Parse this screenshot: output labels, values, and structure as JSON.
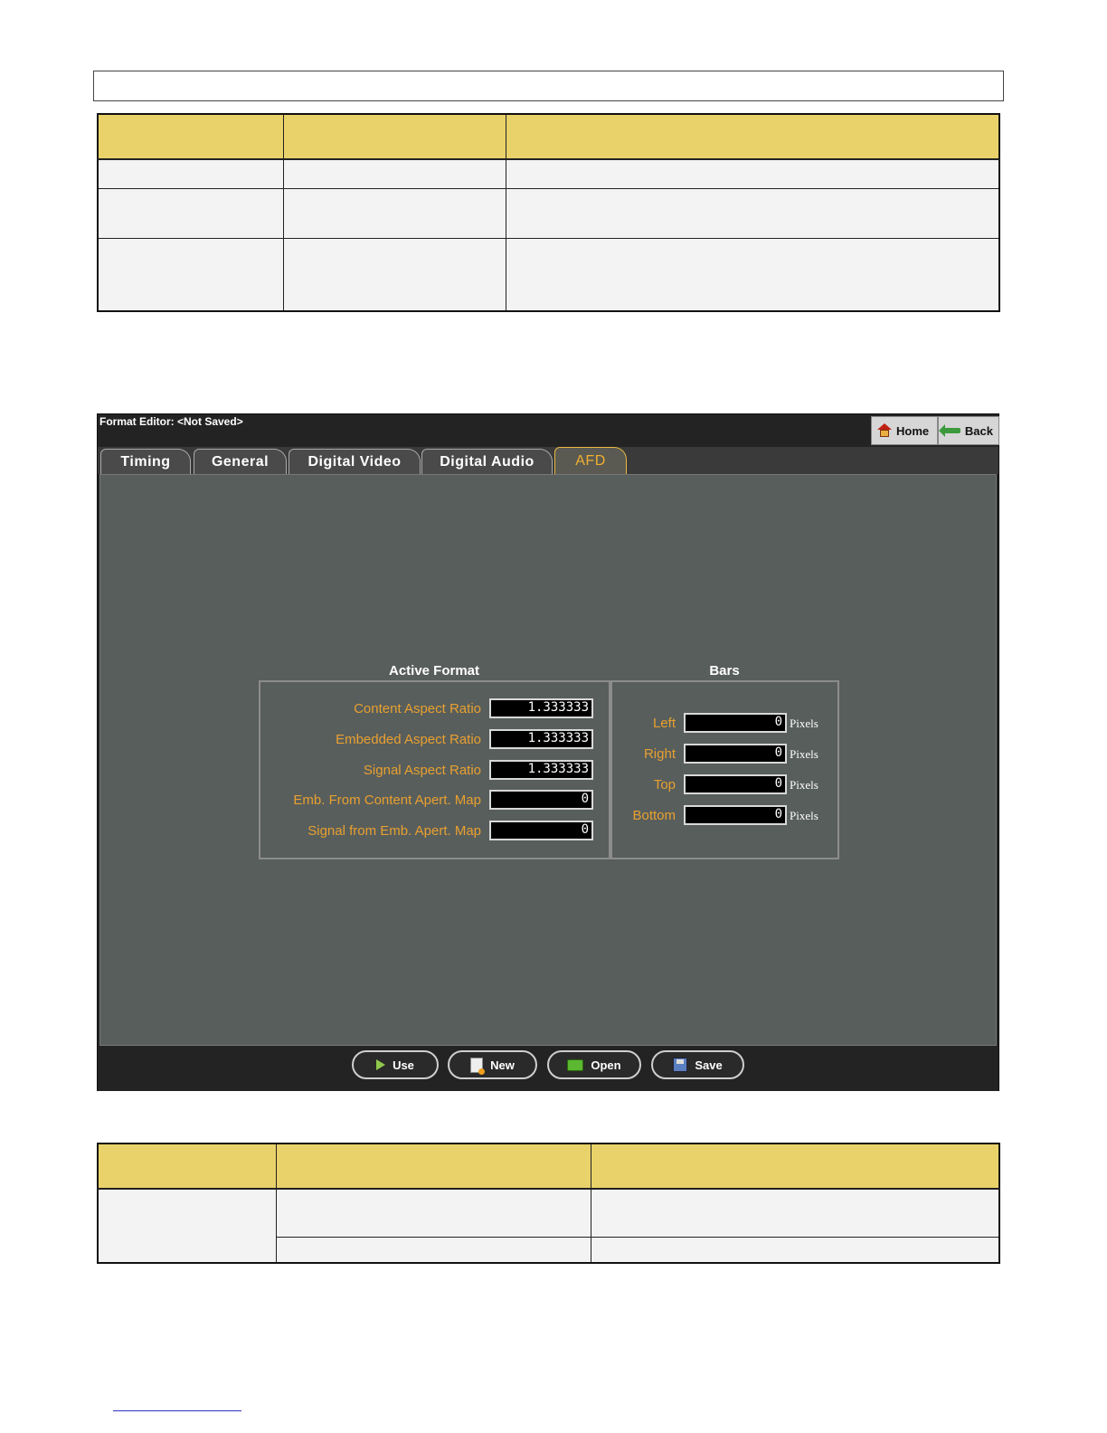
{
  "app": {
    "title": "Format Editor: <Not Saved>",
    "nav": {
      "home": "Home",
      "back": "Back"
    },
    "tabs": [
      {
        "label": "Timing"
      },
      {
        "label": "General"
      },
      {
        "label": "Digital Video"
      },
      {
        "label": "Digital Audio"
      },
      {
        "label": "AFD",
        "active": true
      }
    ],
    "active_format": {
      "title": "Active Format",
      "fields": [
        {
          "label": "Content Aspect Ratio",
          "value": "1.333333"
        },
        {
          "label": "Embedded Aspect Ratio",
          "value": "1.333333"
        },
        {
          "label": "Signal Aspect Ratio",
          "value": "1.333333"
        },
        {
          "label": "Emb. From Content Apert. Map",
          "value": "0"
        },
        {
          "label": "Signal from Emb. Apert. Map",
          "value": "0"
        }
      ]
    },
    "bars": {
      "title": "Bars",
      "unit": "Pixels",
      "fields": [
        {
          "label": "Left",
          "value": "0"
        },
        {
          "label": "Right",
          "value": "0"
        },
        {
          "label": "Top",
          "value": "0"
        },
        {
          "label": "Bottom",
          "value": "0"
        }
      ]
    },
    "actions": {
      "use": "Use",
      "new": "New",
      "open": "Open",
      "save": "Save"
    },
    "colors": {
      "label_accent": "#e8a030",
      "table_header": "#ead26a"
    }
  }
}
